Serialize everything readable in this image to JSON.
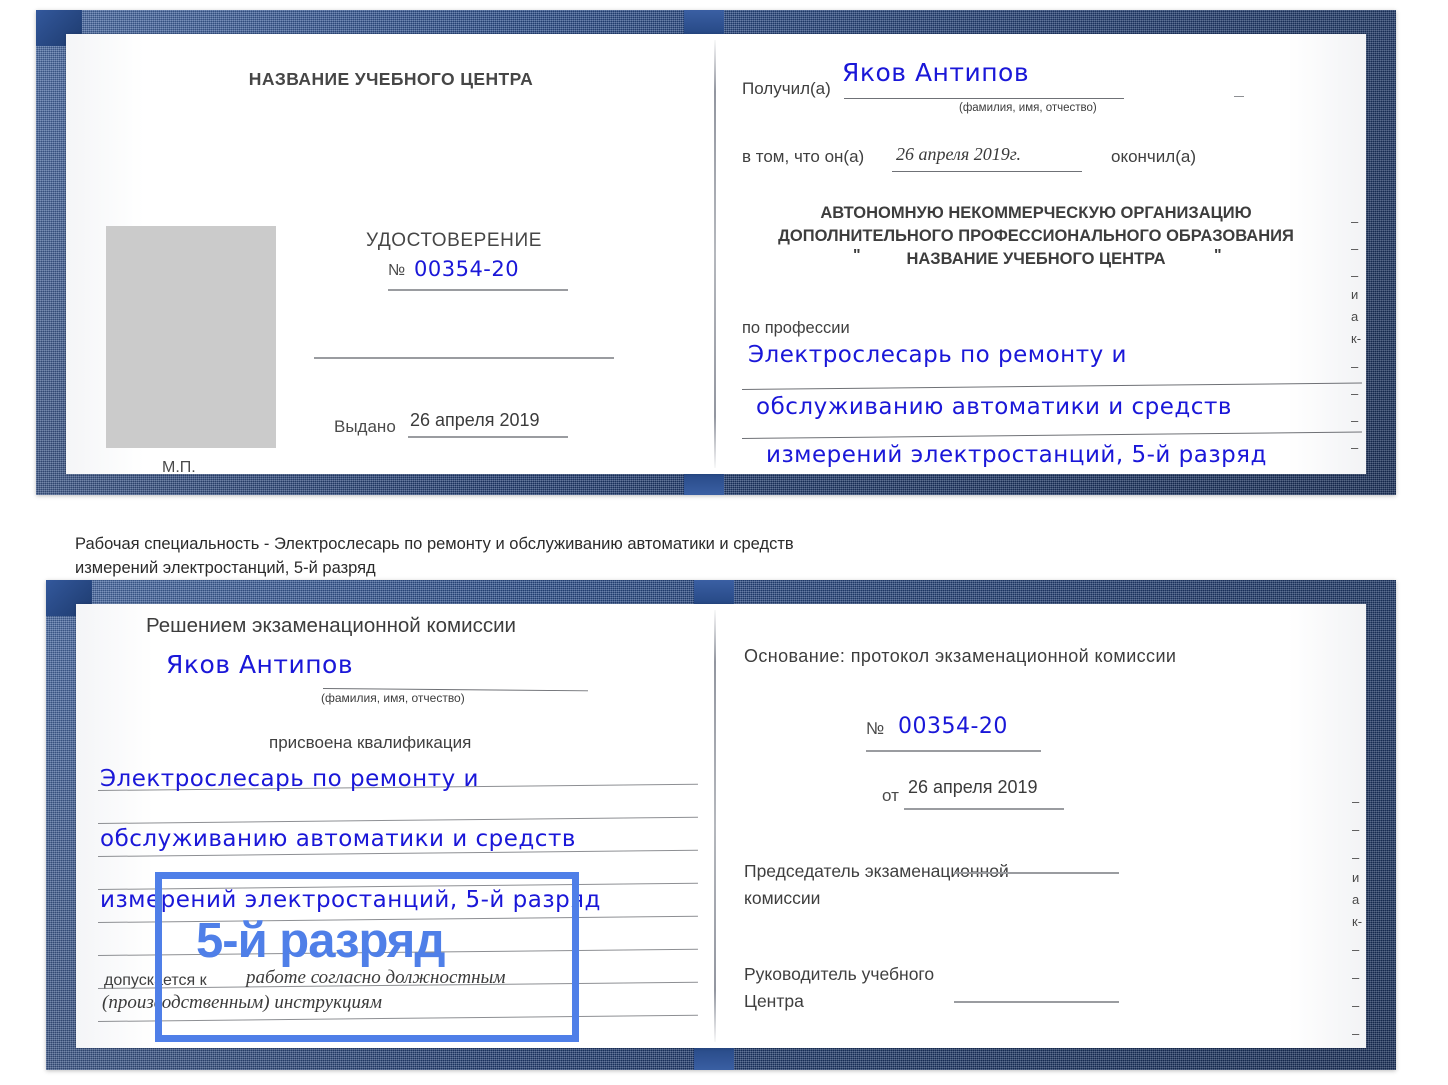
{
  "caption": {
    "line1": "Рабочая специальность - Электрослесарь по ремонту и обслуживанию автоматики и средств",
    "line2": "измерений электростанций, 5-й разряд"
  },
  "certificate_top": {
    "left_page": {
      "header": "НАЗВАНИЕ УЧЕБНОГО ЦЕНТРА",
      "title": "УДОСТОВЕРЕНИЕ",
      "number_label": "№",
      "number_value": "00354-20",
      "issued_label": "Выдано",
      "issued_value": "26 апреля 2019",
      "seal_label": "М.П.",
      "photo_placeholder": "photo-placeholder"
    },
    "right_page": {
      "received_label": "Получил(а)",
      "received_value": "Яков Антипов",
      "fio_hint": "(фамилия, имя, отчество)",
      "inthat_label": "в том, что он(а)",
      "inthat_value": "26 апреля 2019г.",
      "finished_label": "окончил(а)",
      "org_line1": "АВТОНОМНУЮ НЕКОММЕРЧЕСКУЮ ОРГАНИЗАЦИЮ",
      "org_line2": "ДОПОЛНИТЕЛЬНОГО ПРОФЕССИОНАЛЬНОГО ОБРАЗОВАНИЯ",
      "org_quote_open": "\"",
      "org_name": "НАЗВАНИЕ УЧЕБНОГО ЦЕНТРА",
      "org_quote_close": "\"",
      "profession_label": "по профессии",
      "profession_line1": "Электрослесарь по ремонту и",
      "profession_line2": "обслуживанию автоматики и средств",
      "profession_line3": "измерений электростанций, 5-й разряд",
      "edge_fragments": [
        "и",
        "а",
        "к-"
      ]
    }
  },
  "certificate_bottom": {
    "left_page": {
      "header": "Решением экзаменационной комиссии",
      "name_value": "Яков Антипов",
      "fio_hint": "(фамилия, имя, отчество)",
      "qualification_label": "присвоена квалификация",
      "qual_line1": "Электрослесарь по ремонту и",
      "qual_line2": "обслуживанию автоматики и средств",
      "qual_line3": "измерений электростанций, 5-й разряд",
      "admitted_label": "допускается к",
      "admitted_value1": "работе согласно должностным",
      "admitted_value2": "(производственным) инструкциям"
    },
    "right_page": {
      "basis_label": "Основание: протокол экзаменационной комиссии",
      "number_label": "№",
      "number_value": "00354-20",
      "date_label": "от",
      "date_value": "26 апреля 2019",
      "chairman_line1": "Председатель экзаменационной",
      "chairman_line2": "комиссии",
      "head_line1": "Руководитель учебного",
      "head_line2": "Центра",
      "edge_fragments": [
        "и",
        "а",
        "к-"
      ]
    }
  },
  "highlight": {
    "label": "5-й разряд",
    "box_color": "#4f7fe8"
  },
  "colors": {
    "cover_blue": "#224078",
    "ink_blue": "#1a17d8",
    "paper": "#fdfdfd",
    "rule_gray": "#8d8f93",
    "text_gray": "#3b3b3b",
    "photo_gray": "#cbcbcb"
  }
}
